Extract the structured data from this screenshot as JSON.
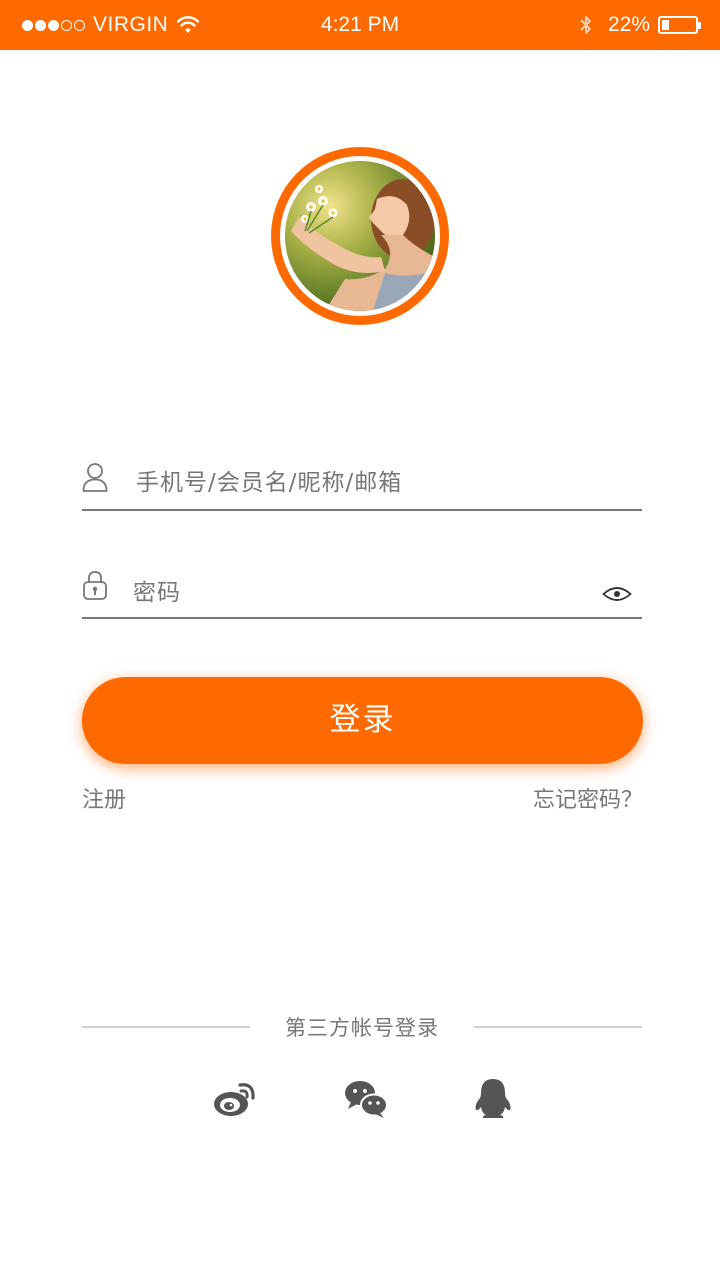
{
  "status_bar": {
    "carrier": "VIRGIN",
    "time": "4:21 PM",
    "battery_text": "22%",
    "battery_level": 0.22,
    "signal_bars_filled": 3,
    "signal_bars_total": 5,
    "icons": [
      "signal-dots-icon",
      "wifi-icon",
      "bluetooth-icon",
      "battery-icon"
    ]
  },
  "avatar": {
    "description_icon": "avatar-photo"
  },
  "form": {
    "username_placeholder": "手机号/会员名/昵称/邮箱",
    "password_placeholder": "密码",
    "username_icon": "user-icon",
    "password_icon": "lock-icon",
    "show_password_icon": "eye-icon"
  },
  "actions": {
    "login_label": "登录",
    "register_label": "注册",
    "forgot_label": "忘记密码？"
  },
  "third_party": {
    "title": "第三方帐号登录",
    "providers": [
      {
        "icon": "weibo-icon"
      },
      {
        "icon": "wechat-icon"
      },
      {
        "icon": "qq-icon"
      }
    ]
  },
  "colors": {
    "accent": "#ff6a00",
    "text_secondary": "#777777",
    "divider": "#cfcfcf",
    "icon_dark": "#555555"
  }
}
